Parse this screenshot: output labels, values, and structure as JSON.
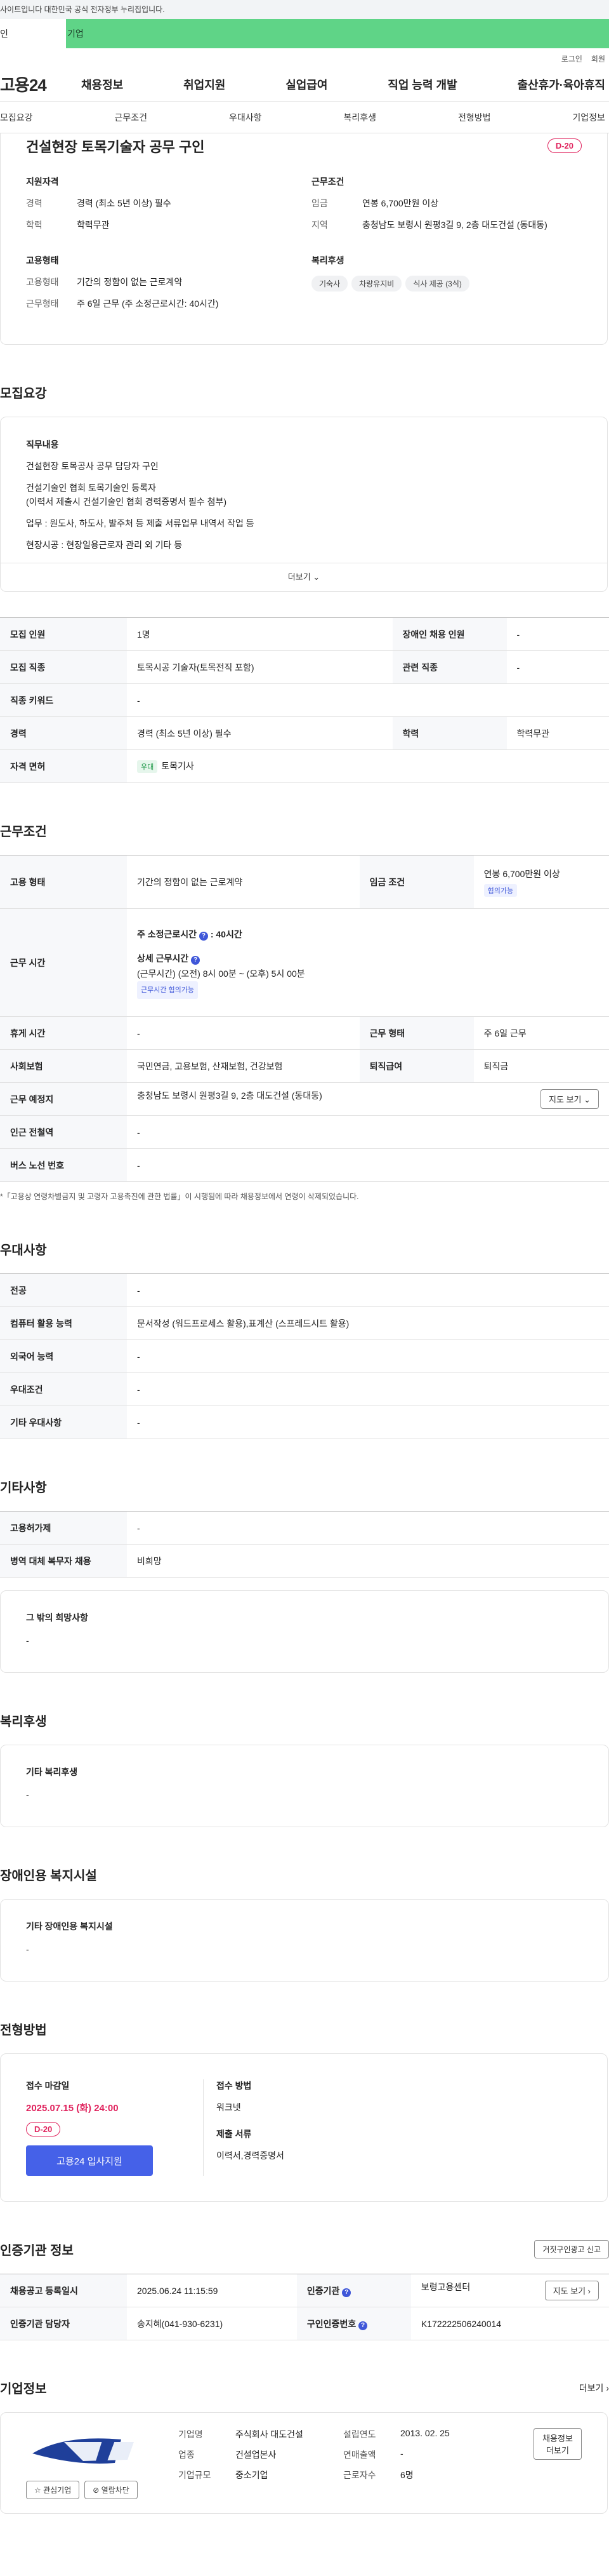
{
  "gov_banner": "사이트입니다 대한민국 공식 전자정부 누리집입니다.",
  "member_tabs": [
    "인",
    "기업"
  ],
  "util": [
    "로그인",
    "회원"
  ],
  "logo": "고용24",
  "gnb": [
    "채용정보",
    "취업지원",
    "실업급여",
    "직업 능력 개발",
    "출산휴가·육아휴직"
  ],
  "anchors": [
    "모집요강",
    "근무조건",
    "우대사항",
    "복리후생",
    "전형방법",
    "기업정보"
  ],
  "job": {
    "title": "건설현장 토목기술자 공무 구인",
    "dday": "D-20",
    "qual_title": "지원자격",
    "qual": [
      {
        "k": "경력",
        "v": "경력 (최소 5년 이상) 필수"
      },
      {
        "k": "학력",
        "v": "학력무관"
      }
    ],
    "cond_title": "근무조건",
    "cond": [
      {
        "k": "임금",
        "v": "연봉 6,700만원 이상"
      },
      {
        "k": "지역",
        "v": "충청남도 보령시 원평3길 9, 2층 대도건설 (동대동)"
      }
    ],
    "emp_title": "고용형태",
    "emp": [
      {
        "k": "고용형태",
        "v": "기간의 정함이 없는 근로계약"
      },
      {
        "k": "근무형태",
        "v": "주 6일 근무 (주 소정근로시간: 40시간)"
      }
    ],
    "welfare_title": "복리후생",
    "welfare": [
      "기숙사",
      "차량유지비",
      "식사 제공 (3식)"
    ]
  },
  "recruit": {
    "title": "모집요강",
    "duty_title": "직무내용",
    "duty": [
      "건설현장 토목공사 공무 담당자 구인",
      "건설기술인 협회 토목기술인 등록자",
      "(이력서 제출시 건설기술인 협회 경력증명서 필수 첨부)",
      "업무 : 원도사, 하도사, 발주처 등 제출 서류업무 내역서 작업 등",
      "현장시공 : 현장일용근로자 관리 외 기타 등"
    ],
    "more": "더보기 ⌄",
    "rows": [
      [
        "모집 인원",
        "1명",
        "장애인 채용 인원",
        "-"
      ],
      [
        "모집 직종",
        "토목시공 기술자(토목전직 포함)",
        "관련 직종",
        "-"
      ],
      [
        "직종 키워드",
        "-"
      ],
      [
        "경력",
        "경력 (최소 5년 이상) 필수",
        "학력",
        "학력무관"
      ],
      [
        "자격 면허",
        "토목기사"
      ]
    ],
    "license_tag": "우대"
  },
  "work": {
    "title": "근무조건",
    "emp_type_k": "고용 형태",
    "emp_type_v": "기간의 정함이 없는 근로계약",
    "wage_k": "임금 조건",
    "wage_v": "연봉 6,700만원 이상",
    "wage_tag": "협의가능",
    "hours_k": "근무 시간",
    "hours_main": "주 소정근로시간",
    "hours_val": ": 40시간",
    "hours_detail_t": "상세 근무시간",
    "hours_detail": "(근무시간) (오전) 8시 00분 ~ (오후) 5시 00분",
    "hours_tag": "근무시간 협의가능",
    "rows": [
      [
        "휴게 시간",
        "-",
        "근무 형태",
        "주 6일 근무"
      ],
      [
        "사회보험",
        "국민연금, 고용보험, 산재보험, 건강보험",
        "퇴직급여",
        "퇴직금"
      ]
    ],
    "place_k": "근무 예정지",
    "place_v": "충청남도 보령시 원평3길 9, 2층 대도건설 (동대동)",
    "map_btn": "지도 보기 ⌄",
    "rows2": [
      [
        "인근 전철역",
        "-"
      ],
      [
        "버스 노선 번호",
        "-"
      ]
    ],
    "note": "*「고용상 연령차별금지 및 고령자 고용촉진에 관한 법률」이 시행됨에 따라 채용정보에서 연령이 삭제되었습니다."
  },
  "pref": {
    "title": "우대사항",
    "rows": [
      [
        "전공",
        "-"
      ],
      [
        "컴퓨터 활용 능력",
        "문서작성 (워드프로세스 활용),표계산 (스프레드시트 활용)"
      ],
      [
        "외국어 능력",
        "-"
      ],
      [
        "우대조건",
        "-"
      ],
      [
        "기타 우대사항",
        "-"
      ]
    ]
  },
  "etc": {
    "title": "기타사항",
    "rows": [
      [
        "고용허가제",
        "-"
      ],
      [
        "병역 대체 복무자 채용",
        "비희망"
      ]
    ],
    "box_t": "그 밖의 희망사항",
    "box_v": "-"
  },
  "welfare": {
    "title": "복리후생",
    "box_t": "기타 복리후생",
    "box_v": "-"
  },
  "disabled": {
    "title": "장애인용 복지시설",
    "box_t": "기타 장애인용 복지시설",
    "box_v": "-"
  },
  "apply": {
    "title": "전형방법",
    "deadline_t": "접수 마감일",
    "deadline": "2025.07.15 (화) 24:00",
    "dday": "D-20",
    "btn": "고용24 입사지원",
    "method_t": "접수 방법",
    "method": "워크넷",
    "docs_t": "제출 서류",
    "docs": "이력서,경력증명서"
  },
  "cert": {
    "title": "인증기관 정보",
    "report_btn": "거짓구인광고 신고",
    "rows": [
      [
        "채용공고 등록일시",
        "2025.06.24 11:15:59",
        "인증기관",
        "보령고용센터"
      ],
      [
        "인증기관 담당자",
        "송지혜(041-930-6231)",
        "구인인증번호",
        "K172222506240014"
      ]
    ],
    "map_btn": "지도 보기 ›"
  },
  "company": {
    "title": "기업정보",
    "more": "더보기 ›",
    "interest": "☆ 관심기업",
    "block": "⊘ 열람차단",
    "jobs_btn": "채용정보 더보기",
    "items": [
      [
        "기업명",
        "주식회사 대도건설"
      ],
      [
        "설립연도",
        "2013. 02. 25"
      ],
      [
        "업종",
        "건설업본사"
      ],
      [
        "연매출액",
        "-"
      ],
      [
        "기업규모",
        "중소기업"
      ],
      [
        "근로자수",
        "6명"
      ]
    ]
  }
}
